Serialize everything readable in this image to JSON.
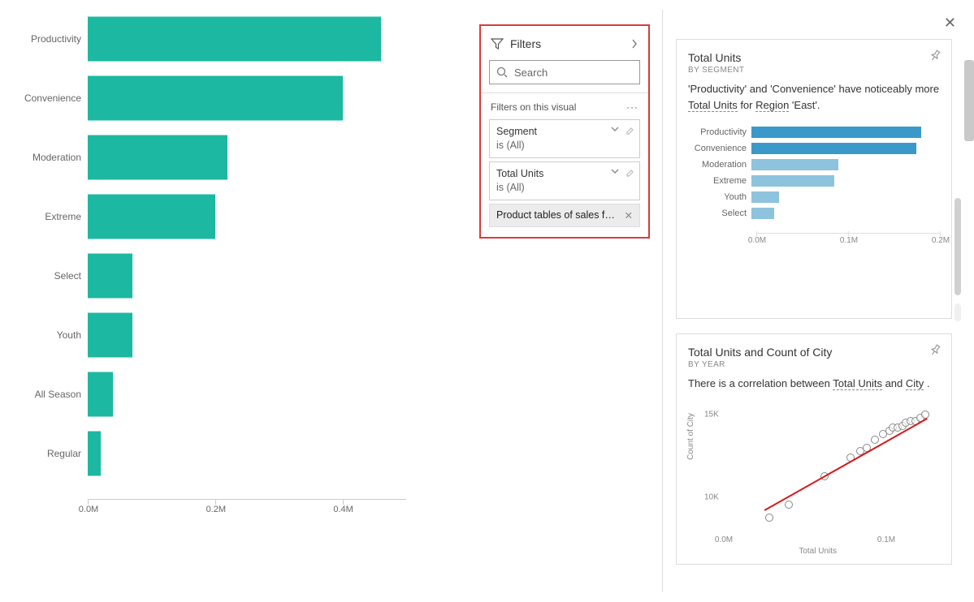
{
  "filters": {
    "title": "Filters",
    "search_placeholder": "Search",
    "section_title": "Filters on this visual",
    "cards": [
      {
        "name": "Segment",
        "state": "is (All)"
      },
      {
        "name": "Total Units",
        "state": "is (All)"
      }
    ],
    "drag_chip": "Product tables of sales f…"
  },
  "insight1": {
    "title": "Total Units",
    "subtitle": "BY SEGMENT",
    "text_parts": [
      "'Productivity' and 'Convenience' have noticeably more ",
      "Total Units",
      " for ",
      "Region",
      " 'East'."
    ]
  },
  "insight2": {
    "title": "Total Units and Count of City",
    "subtitle": "BY YEAR",
    "text_parts": [
      "There is a correlation between ",
      "Total Units",
      " and ",
      "City",
      " ."
    ],
    "xlabel": "Total Units",
    "ylabel": "Count of City"
  },
  "chart_data": [
    {
      "id": "main_bar",
      "type": "bar",
      "orientation": "horizontal",
      "categories": [
        "Productivity",
        "Convenience",
        "Moderation",
        "Extreme",
        "Select",
        "Youth",
        "All Season",
        "Regular"
      ],
      "values_M": [
        0.46,
        0.4,
        0.22,
        0.2,
        0.07,
        0.07,
        0.04,
        0.02
      ],
      "xlim_M": [
        0.0,
        0.5
      ],
      "xticks_M": [
        0.0,
        0.2,
        0.4
      ],
      "xtick_labels": [
        "0.0M",
        "0.2M",
        "0.4M"
      ],
      "color": "#1DB8A1"
    },
    {
      "id": "insight1_bar",
      "type": "bar",
      "orientation": "horizontal",
      "categories": [
        "Productivity",
        "Convenience",
        "Moderation",
        "Extreme",
        "Youth",
        "Select"
      ],
      "values_M": [
        0.185,
        0.18,
        0.095,
        0.09,
        0.03,
        0.025
      ],
      "highlight_index": [
        0,
        1
      ],
      "colors": {
        "highlight": "#3B99C9",
        "rest": "#8EC3DE"
      },
      "xlim_M": [
        0.0,
        0.2
      ],
      "xticks_M": [
        0.0,
        0.1,
        0.2
      ],
      "xtick_labels": [
        "0.0M",
        "0.1M",
        "0.2M"
      ]
    },
    {
      "id": "insight2_scatter",
      "type": "scatter",
      "xlabel": "Total Units",
      "ylabel": "Count of City",
      "xlim_M": [
        0.0,
        0.13
      ],
      "ylim_K": [
        8.0,
        15.5
      ],
      "xticks_M": [
        0.0,
        0.1
      ],
      "xtick_labels": [
        "0.0M",
        "0.1M"
      ],
      "yticks_K": [
        10,
        15
      ],
      "ytick_labels": [
        "10K",
        "15K"
      ],
      "points": [
        {
          "x_M": 0.028,
          "y_K": 8.8
        },
        {
          "x_M": 0.04,
          "y_K": 9.6
        },
        {
          "x_M": 0.062,
          "y_K": 11.3
        },
        {
          "x_M": 0.078,
          "y_K": 12.4
        },
        {
          "x_M": 0.084,
          "y_K": 12.8
        },
        {
          "x_M": 0.088,
          "y_K": 13.0
        },
        {
          "x_M": 0.093,
          "y_K": 13.5
        },
        {
          "x_M": 0.098,
          "y_K": 13.8
        },
        {
          "x_M": 0.102,
          "y_K": 14.0
        },
        {
          "x_M": 0.104,
          "y_K": 14.2
        },
        {
          "x_M": 0.107,
          "y_K": 14.2
        },
        {
          "x_M": 0.11,
          "y_K": 14.3
        },
        {
          "x_M": 0.112,
          "y_K": 14.5
        },
        {
          "x_M": 0.115,
          "y_K": 14.6
        },
        {
          "x_M": 0.118,
          "y_K": 14.6
        },
        {
          "x_M": 0.121,
          "y_K": 14.8
        },
        {
          "x_M": 0.124,
          "y_K": 15.0
        }
      ],
      "trend": {
        "x1_M": 0.025,
        "y1_K": 9.3,
        "x2_M": 0.125,
        "y2_K": 14.8
      }
    }
  ]
}
